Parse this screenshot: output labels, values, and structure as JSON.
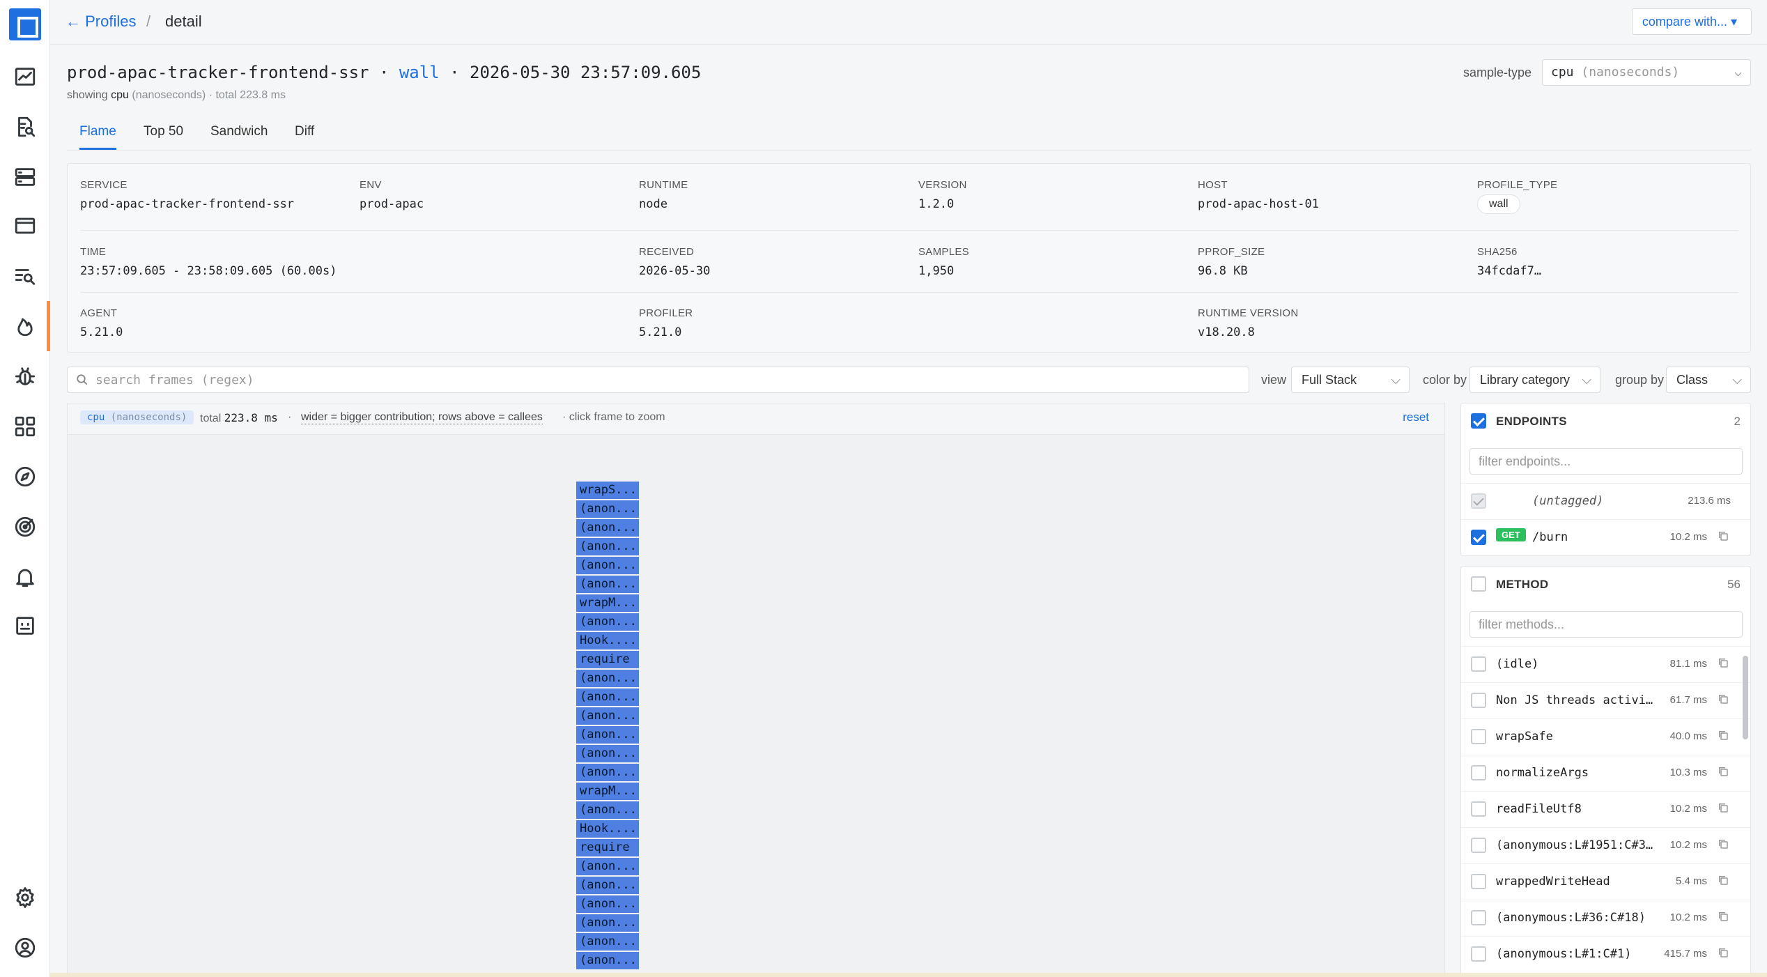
{
  "breadcrumb": {
    "back_label": "← Profiles",
    "separator": "/",
    "current": "detail"
  },
  "compare_button": "compare with... ▾",
  "header": {
    "service": "prod-apac-tracker-frontend-ssr",
    "dot1": "·",
    "profile_type": "wall",
    "dot2": "·",
    "timestamp": "2026-05-30 23:57:09.605",
    "showing_label": "showing",
    "showing_value": "cpu",
    "showing_unit": "(nanoseconds)",
    "total_text": "· total 223.8 ms"
  },
  "sample_type": {
    "label": "sample-type",
    "value": "cpu",
    "unit": "(nanoseconds)"
  },
  "tabs": [
    {
      "label": "Flame",
      "active": true
    },
    {
      "label": "Top 50"
    },
    {
      "label": "Sandwich"
    },
    {
      "label": "Diff"
    }
  ],
  "metadata": {
    "service": {
      "key": "SERVICE",
      "value": "prod-apac-tracker-frontend-ssr"
    },
    "env": {
      "key": "ENV",
      "value": "prod-apac"
    },
    "runtime": {
      "key": "RUNTIME",
      "value": "node"
    },
    "version": {
      "key": "VERSION",
      "value": "1.2.0"
    },
    "host": {
      "key": "HOST",
      "value": "prod-apac-host-01"
    },
    "profile_type": {
      "key": "PROFILE_TYPE",
      "value": "wall"
    },
    "time": {
      "key": "TIME",
      "value": "23:57:09.605 - 23:58:09.605 (60.00s)"
    },
    "received": {
      "key": "RECEIVED",
      "value": "2026-05-30"
    },
    "samples": {
      "key": "SAMPLES",
      "value": "1,950"
    },
    "pprof_size": {
      "key": "PPROF_SIZE",
      "value": "96.8 KB"
    },
    "sha256": {
      "key": "SHA256",
      "value": "34fcdaf7…"
    },
    "agent": {
      "key": "AGENT",
      "value": "5.21.0"
    },
    "profiler": {
      "key": "PROFILER",
      "value": "5.21.0"
    },
    "runtime_version": {
      "key": "RUNTIME VERSION",
      "value": "v18.20.8"
    }
  },
  "search": {
    "placeholder": "search frames (regex)"
  },
  "controls": {
    "view_label": "view",
    "view_value": "Full Stack",
    "color_label": "color by",
    "color_value": "Library category",
    "group_label": "group by",
    "group_value": "Class"
  },
  "flame_header": {
    "badge": "cpu",
    "badge_unit": "(nanoseconds)",
    "total_label": "total",
    "total_value": "223.8 ms",
    "sep": "·",
    "hint": "wider = bigger contribution; rows above = callees",
    "hint2": "· click frame to zoom",
    "reset": "reset"
  },
  "frames": [
    "wrapS...",
    "(anon...",
    "(anon...",
    "(anon...",
    "(anon...",
    "(anon...",
    "wrapM...",
    "(anon...",
    "Hook....",
    "require",
    "(anon...",
    "(anon...",
    "(anon...",
    "(anon...",
    "(anon...",
    "(anon...",
    "wrapM...",
    "(anon...",
    "Hook....",
    "require",
    "(anon...",
    "(anon...",
    "(anon...",
    "(anon...",
    "(anon...",
    "(anon..."
  ],
  "endpoints": {
    "title": "ENDPOINTS",
    "count": "2",
    "filter_placeholder": "filter endpoints...",
    "items": [
      {
        "name": "(untagged)",
        "value": "213.6 ms"
      },
      {
        "method": "GET",
        "name": "/burn",
        "value": "10.2 ms"
      }
    ]
  },
  "methods": {
    "title": "METHOD",
    "count": "56",
    "filter_placeholder": "filter methods...",
    "items": [
      {
        "name": "(idle)",
        "value": "81.1 ms"
      },
      {
        "name": "Non JS threads activi…",
        "value": "61.7 ms"
      },
      {
        "name": "wrapSafe",
        "value": "40.0 ms"
      },
      {
        "name": "normalizeArgs",
        "value": "10.3 ms"
      },
      {
        "name": "readFileUtf8",
        "value": "10.2 ms"
      },
      {
        "name": "(anonymous:L#1951:C#3…",
        "value": "10.2 ms"
      },
      {
        "name": "wrappedWriteHead",
        "value": "5.4 ms"
      },
      {
        "name": "(anonymous:L#36:C#18)",
        "value": "10.2 ms"
      },
      {
        "name": "(anonymous:L#1:C#1)",
        "value": "415.7 ms"
      }
    ]
  },
  "colors": {
    "accent": "#1e6fe0",
    "frame": "#4f7fe0",
    "active_nav": "#ff8a3d",
    "get_badge": "#2bbf5d"
  }
}
